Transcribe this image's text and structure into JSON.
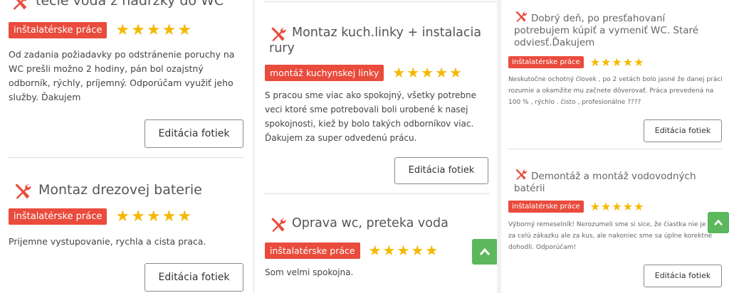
{
  "colors": {
    "badge": "#e94b3c",
    "star": "#f5b800",
    "scroll_top": "#5cb85c",
    "icon": "#e94b3c"
  },
  "edit_label": "Editácia fotiek",
  "columns": [
    {
      "reviews": [
        {
          "title": "tečie voda z nádržky do WC",
          "category": "inštalatérske práce",
          "rating": 5,
          "text": "Od zadania požiadavky po odstránenie poruchy na WC prešli možno 2 hodiny, pán bol ozajstný odborník, rýchly, príjemný. Odporúčam využiť jeho služby. Ďakujem"
        },
        {
          "title": "Montaz drezovej baterie",
          "category": "inštalatérske práce",
          "rating": 5,
          "text": "Prijemne vystupovanie, rychla a cista praca."
        }
      ]
    },
    {
      "reviews": [
        {
          "title": "Montaz kuch.linky + instalacia rury",
          "category": "montáž kuchynskej linky",
          "rating": 5,
          "text": "S pracou sme viac ako spokojný, všetky potrebne veci ktoré sme potrebovali boli urobené k nasej spokojnosti, kiež by bolo takých odborníkov viac. Ďakujem za super odvedenú prácu."
        },
        {
          "title": "Oprava wc, preteka voda",
          "category": "inštalatérske práce",
          "rating": 5,
          "text": "Som velmi spokojna."
        }
      ]
    },
    {
      "reviews": [
        {
          "title": "Dobrý deň, po presťahovaní potrebujem kúpiť a vymeniť WC. Staré odviesť.Ďakujem",
          "category": "inštalatérske práce",
          "rating": 5,
          "text": "Neskutočne ochotný človek , po 2 vetách bolo jasné že danej práci rozumie a okamžite mu začnete dôverovať. Práca prevedená na 100 % , rýchlo . čisto , profesionálne ????"
        },
        {
          "title": "Demontáž a montáž vodovodných batérii",
          "category": "inštalatérske práce",
          "rating": 5,
          "text": "Výborný remeselník! Nerozumeli sme si sice, že čiastka nie je za celú zákazku ale za kus, ale nakoniec sme sa úplne korektne dohodli. Odporúčam!"
        }
      ]
    }
  ]
}
